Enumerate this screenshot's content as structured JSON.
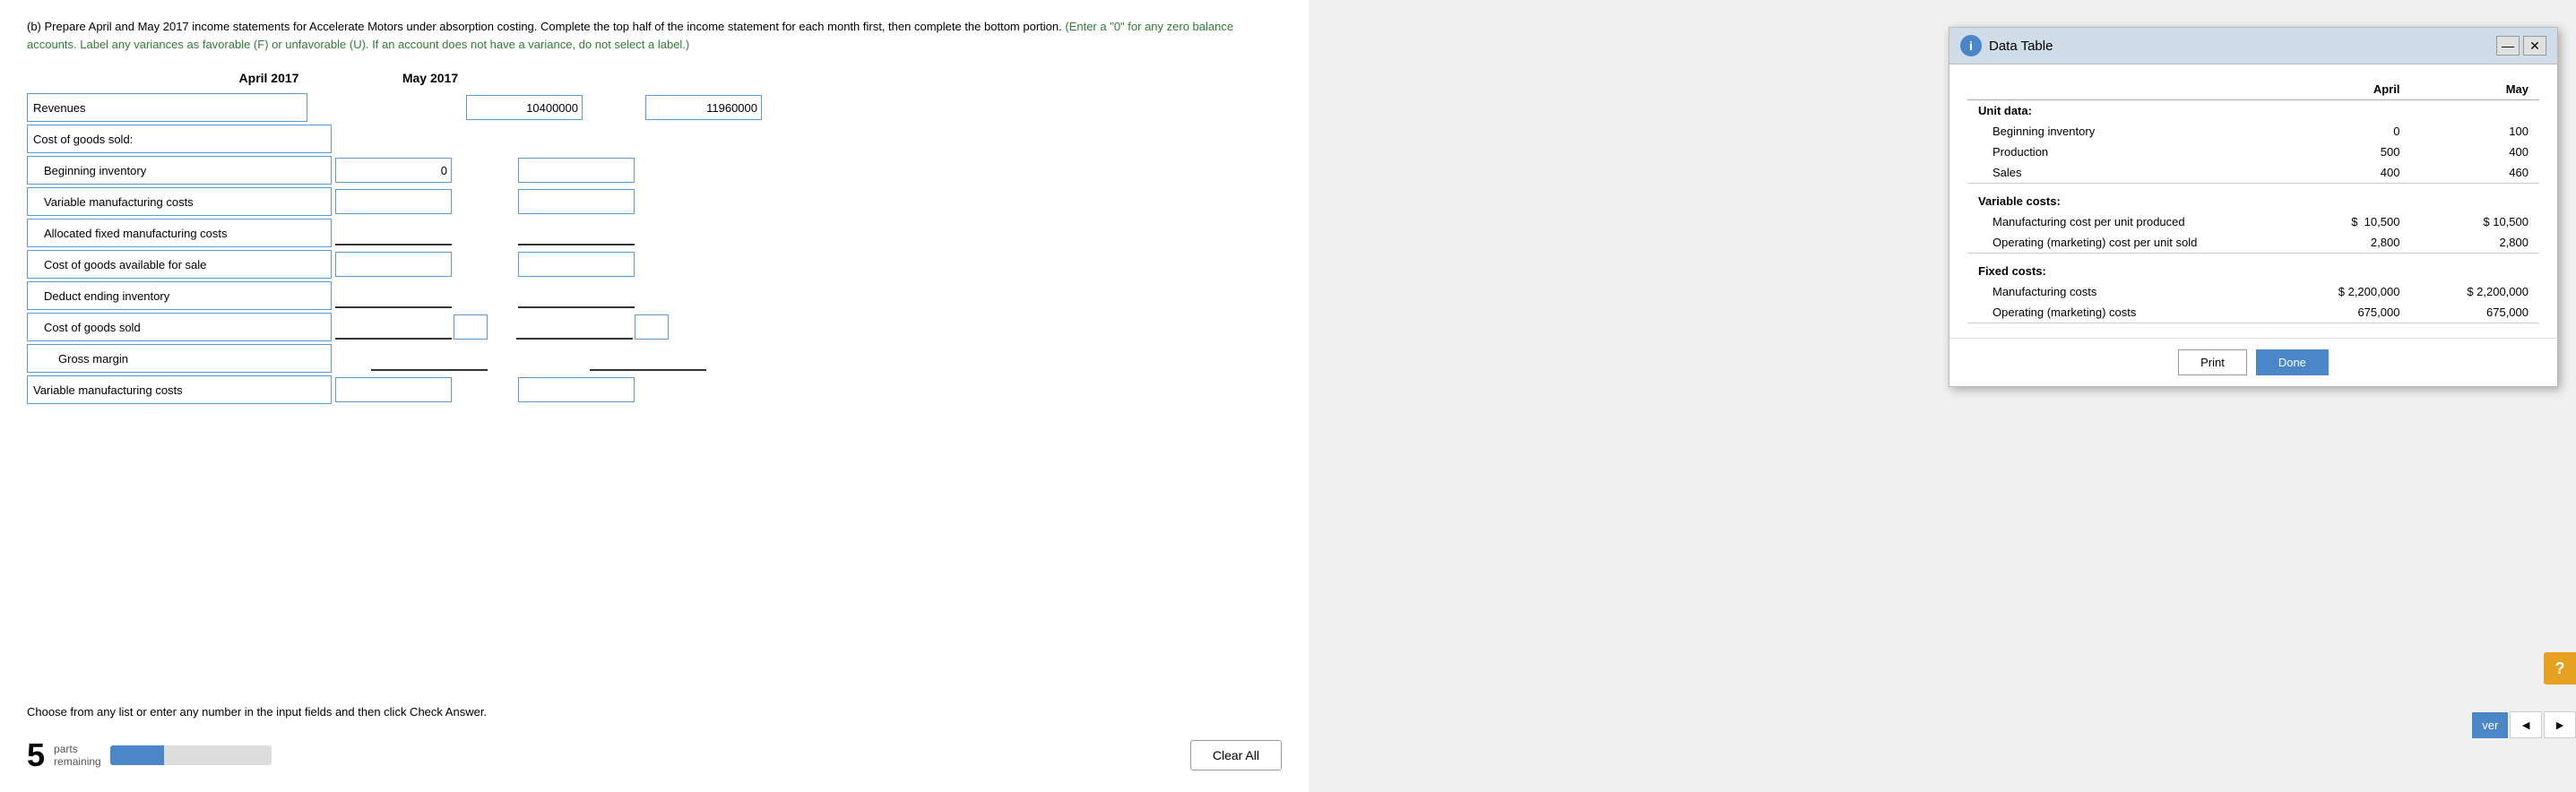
{
  "instructions": {
    "main": "(b) Prepare April and May 2017 income statements for Accelerate Motors under absorption costing. Complete the top half of the income statement for each month first, then complete the bottom portion.",
    "green": "(Enter a \"0\" for any zero balance accounts. Label any variances as favorable (F) or unfavorable (U). If an account does not have a variance, do not select a label.)"
  },
  "columns": {
    "april": "April 2017",
    "may": "May 2017"
  },
  "rows": {
    "revenues": "Revenues",
    "cogs_header": "Cost of goods sold:",
    "beginning_inventory": "Beginning inventory",
    "variable_mfg_costs": "Variable manufacturing costs",
    "allocated_fixed_mfg": "Allocated fixed manufacturing costs",
    "cogs_available": "Cost of goods available for sale",
    "deduct_ending": "Deduct ending inventory",
    "cost_of_goods_sold": "Cost of goods sold",
    "gross_margin": "Gross margin",
    "variable_mfg_costs2": "Variable manufacturing costs"
  },
  "values": {
    "revenues_april": "10400000",
    "revenues_may": "11960000",
    "beginning_inventory_april": "0"
  },
  "footer": {
    "instruction": "Choose from any list or enter any number in the input fields and then click Check Answer.",
    "parts_number": "5",
    "parts_label_line1": "parts",
    "parts_label_line2": "remaining",
    "clear_all": "Clear All"
  },
  "data_table": {
    "title": "Data Table",
    "header_april": "April",
    "header_may": "May",
    "sections": [
      {
        "label": "Unit data:",
        "rows": [
          {
            "label": "Beginning inventory",
            "april": "0",
            "may": "100"
          },
          {
            "label": "Production",
            "april": "500",
            "may": "400"
          },
          {
            "label": "Sales",
            "april": "400",
            "may": "460"
          }
        ]
      },
      {
        "label": "Variable costs:",
        "rows": [
          {
            "label": "Manufacturing cost per unit produced",
            "april_prefix": "$",
            "april": "10,500",
            "may_prefix": "$",
            "may": "10,500"
          },
          {
            "label": "Operating (marketing) cost per unit sold",
            "april": "2,800",
            "may": "2,800"
          }
        ]
      },
      {
        "label": "Fixed costs:",
        "rows": [
          {
            "label": "Manufacturing costs",
            "april_prefix": "$",
            "april": "2,200,000",
            "may_prefix": "$",
            "may": "2,200,000"
          },
          {
            "label": "Operating (marketing) costs",
            "april": "675,000",
            "may": "675,000"
          }
        ]
      }
    ],
    "buttons": {
      "print": "Print",
      "done": "Done"
    }
  },
  "nav": {
    "ver": "ver",
    "prev": "◄",
    "next": "►"
  },
  "help": "?"
}
